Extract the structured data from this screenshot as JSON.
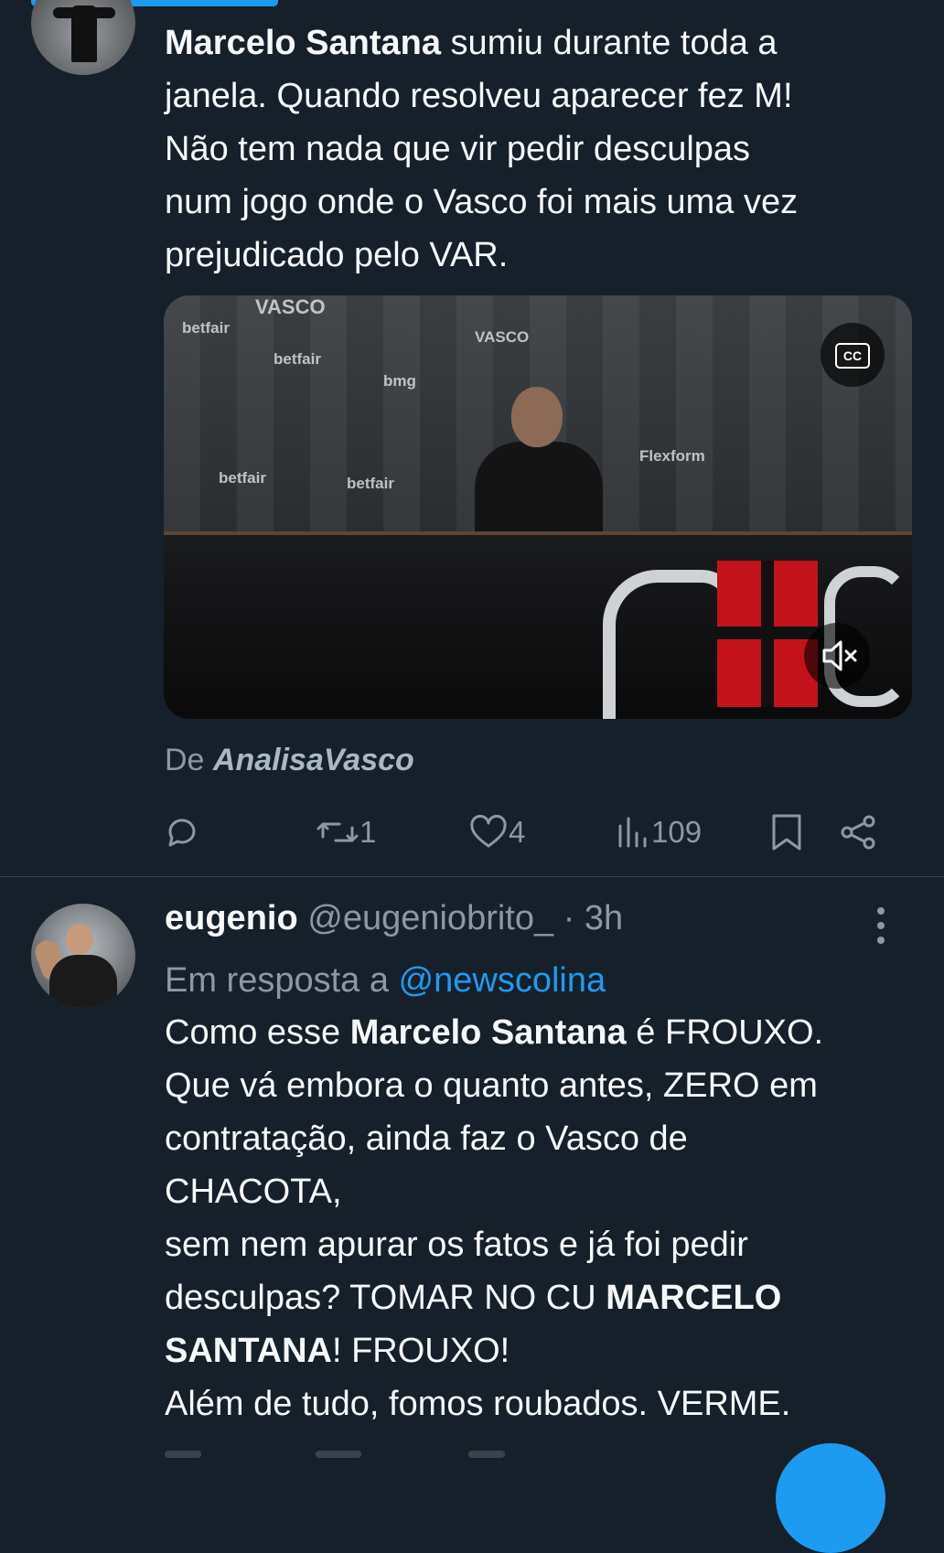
{
  "colors": {
    "background": "#15202b",
    "accent": "#1d9bf0",
    "muted": "#8b98a5",
    "text": "#f7f9f9"
  },
  "tweet1": {
    "text_bold": "Marcelo Santana",
    "text_rest": " sumiu durante toda a\njanela. Quando resolveu aparecer fez M!\nNão tem nada que vir pedir desculpas\nnum jogo onde o Vasco foi mais uma vez\nprejudicado pelo VAR.",
    "media": {
      "cc_label": "CC",
      "backdrop_words": [
        "VASCO",
        "betfair",
        "bmg",
        "betfair",
        "VASCO",
        "betfair",
        "Flexform",
        "betfair"
      ]
    },
    "source_prefix": "De ",
    "source_name": "AnalisaVasco",
    "actions": {
      "replies": "",
      "retweets": "1",
      "likes": "4",
      "views": "109"
    }
  },
  "tweet2": {
    "display_name": "eugenio",
    "handle": "@eugeniobrito_",
    "time": "· 3h",
    "reply_prefix": "Em resposta a ",
    "reply_mention": "@newscolina",
    "text_parts": {
      "p1": "Como esse ",
      "b1": "Marcelo Santana",
      "p2": " é FROUXO.\nQue vá embora o quanto antes, ZERO em\ncontratação, ainda faz o Vasco de\nCHACOTA,\nsem nem apurar os fatos e já foi pedir\ndesculpas? TOMAR NO CU ",
      "b2": "MARCELO\nSANTANA",
      "p3": "! FROUXO!\nAlém de tudo, fomos roubados. VERME."
    }
  },
  "icons": {
    "reply": "reply-icon",
    "retweet": "retweet-icon",
    "like": "heart-icon",
    "views": "views-icon",
    "bookmark": "bookmark-icon",
    "share": "share-icon",
    "more": "more-vertical-icon",
    "mute": "mute-icon",
    "cc": "closed-captions-icon"
  }
}
